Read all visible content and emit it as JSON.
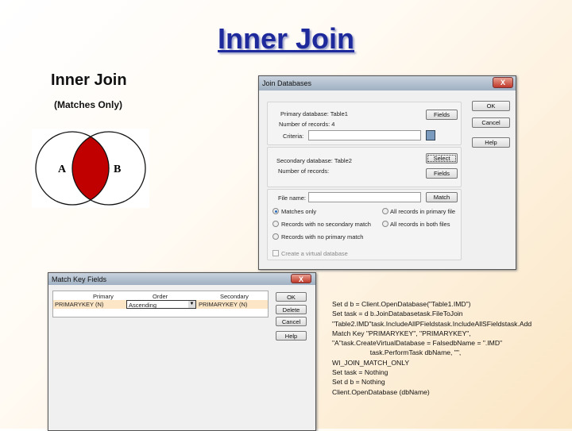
{
  "slide": {
    "title": "Inner Join",
    "subtitle": "Inner Join",
    "caption": "(Matches Only)",
    "venn": {
      "left": "A",
      "right": "B",
      "fill": "#c00000"
    }
  },
  "join_dialog": {
    "title": "Join Databases",
    "close": "X",
    "primary_label": "Primary database: Table1",
    "primary_records": "Number of records: 4",
    "criteria_label": "Criteria:",
    "criteria_value": "",
    "secondary_label": "Secondary database: Table2",
    "secondary_records": "Number of records:",
    "file_name_label": "File name:",
    "file_name_value": "",
    "buttons": {
      "ok": "OK",
      "cancel": "Cancel",
      "help": "Help",
      "fields1": "Fields",
      "select": "Select",
      "fields2": "Fields",
      "match": "Match"
    },
    "options": [
      "Matches only",
      "Records with no secondary match",
      "Records with no primary match",
      "All records in primary file",
      "All records in both files"
    ],
    "selected_option": "Matches only",
    "virtual_db": "Create a virtual database"
  },
  "match_dialog": {
    "title": "Match Key Fields",
    "close": "X",
    "columns": [
      "Primary",
      "Order",
      "Secondary"
    ],
    "rows": [
      {
        "primary": "PRIMARYKEY (N)",
        "order": "Ascending",
        "secondary": "PRIMARYKEY (N)"
      }
    ],
    "buttons": {
      "ok": "OK",
      "delete": "Delete",
      "cancel": "Cancel",
      "help": "Help"
    }
  },
  "code": [
    "Set d b = Client.OpenDatabase(\"Table1.IMD\")",
    "Set task = d b.JoinDatabasetask.FileToJoin",
    "\"Table2.IMD\"task.IncludeAllPFieldstask.IncludeAllSFieldstask.Add",
    "Match Key \"PRIMARYKEY\", \"PRIMARYKEY\",",
    "\"A\"task.CreateVirtualDatabase = FalsedbName = \".IMD\"",
    "                    task.PerformTask dbName, \"\",",
    "WI_JOIN_MATCH_ONLY",
    "Set task = Nothing",
    "Set d b = Nothing",
    "Client.OpenDatabase (dbName)"
  ]
}
